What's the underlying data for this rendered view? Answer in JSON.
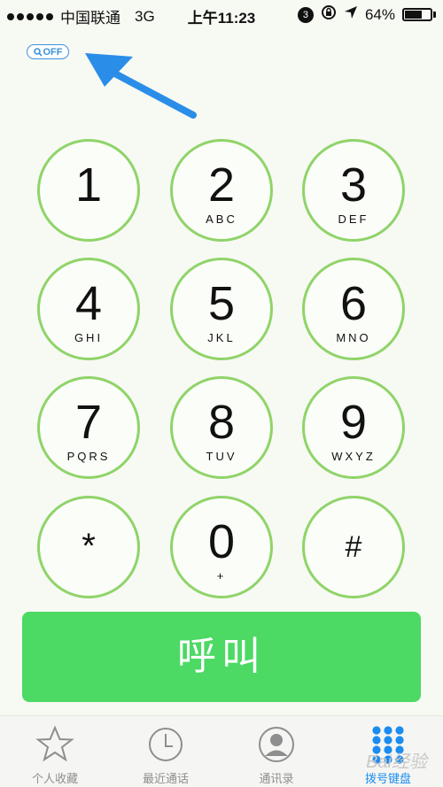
{
  "status_bar": {
    "carrier": "中国联通",
    "network": "3G",
    "time": "上午11:23",
    "notification_count": "3",
    "battery": "64%",
    "battery_level": 0.64
  },
  "off_badge": {
    "label": "OFF"
  },
  "keypad": [
    {
      "digit": "1",
      "letters": ""
    },
    {
      "digit": "2",
      "letters": "ABC"
    },
    {
      "digit": "3",
      "letters": "DEF"
    },
    {
      "digit": "4",
      "letters": "GHI"
    },
    {
      "digit": "5",
      "letters": "JKL"
    },
    {
      "digit": "6",
      "letters": "MNO"
    },
    {
      "digit": "7",
      "letters": "PQRS"
    },
    {
      "digit": "8",
      "letters": "TUV"
    },
    {
      "digit": "9",
      "letters": "WXYZ"
    },
    {
      "digit": "*",
      "letters": ""
    },
    {
      "digit": "0",
      "letters": "+"
    },
    {
      "digit": "#",
      "letters": ""
    }
  ],
  "call_button": {
    "label": "呼叫",
    "color": "#4cd964"
  },
  "tab_bar": {
    "items": [
      {
        "label": "个人收藏",
        "icon": "star-icon",
        "active": false
      },
      {
        "label": "最近通话",
        "icon": "clock-icon",
        "active": false
      },
      {
        "label": "通讯录",
        "icon": "contacts-icon",
        "active": false
      },
      {
        "label": "拨号键盘",
        "icon": "keypad-icon",
        "active": true
      }
    ]
  },
  "watermark": "Bai经验",
  "colors": {
    "key_ring": "#8fd469",
    "accent_blue": "#1c8cf0",
    "arrow_blue": "#2a8ee8"
  }
}
